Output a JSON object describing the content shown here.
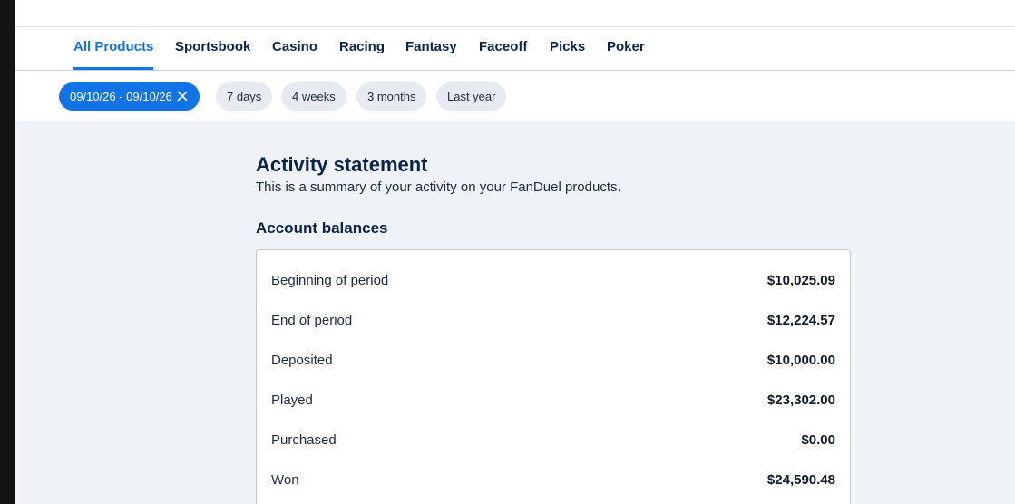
{
  "nav": {
    "tabs": [
      {
        "label": "All Products",
        "active": true
      },
      {
        "label": "Sportsbook"
      },
      {
        "label": "Casino"
      },
      {
        "label": "Racing"
      },
      {
        "label": "Fantasy"
      },
      {
        "label": "Faceoff"
      },
      {
        "label": "Picks"
      },
      {
        "label": "Poker"
      }
    ]
  },
  "filters": {
    "active_range": "09/10/26 - 09/10/26",
    "options": [
      "7 days",
      "4 weeks",
      "3 months",
      "Last year"
    ]
  },
  "statement": {
    "title": "Activity statement",
    "subtitle": "This is a summary of your activity on your FanDuel products."
  },
  "balances": {
    "title": "Account balances",
    "rows": [
      {
        "label": "Beginning of period",
        "value": "$10,025.09"
      },
      {
        "label": "End of period",
        "value": "$12,224.57"
      },
      {
        "label": "Deposited",
        "value": "$10,000.00"
      },
      {
        "label": "Played",
        "value": "$23,302.00"
      },
      {
        "label": "Purchased",
        "value": "$0.00"
      },
      {
        "label": "Won",
        "value": "$24,590.48"
      }
    ]
  },
  "colors": {
    "accent": "#1173e6",
    "navy": "#0a2448",
    "page_bg": "#eff2f7",
    "chip_bg": "#e7ebf1"
  },
  "icons": {
    "clear_range": "close-icon"
  }
}
